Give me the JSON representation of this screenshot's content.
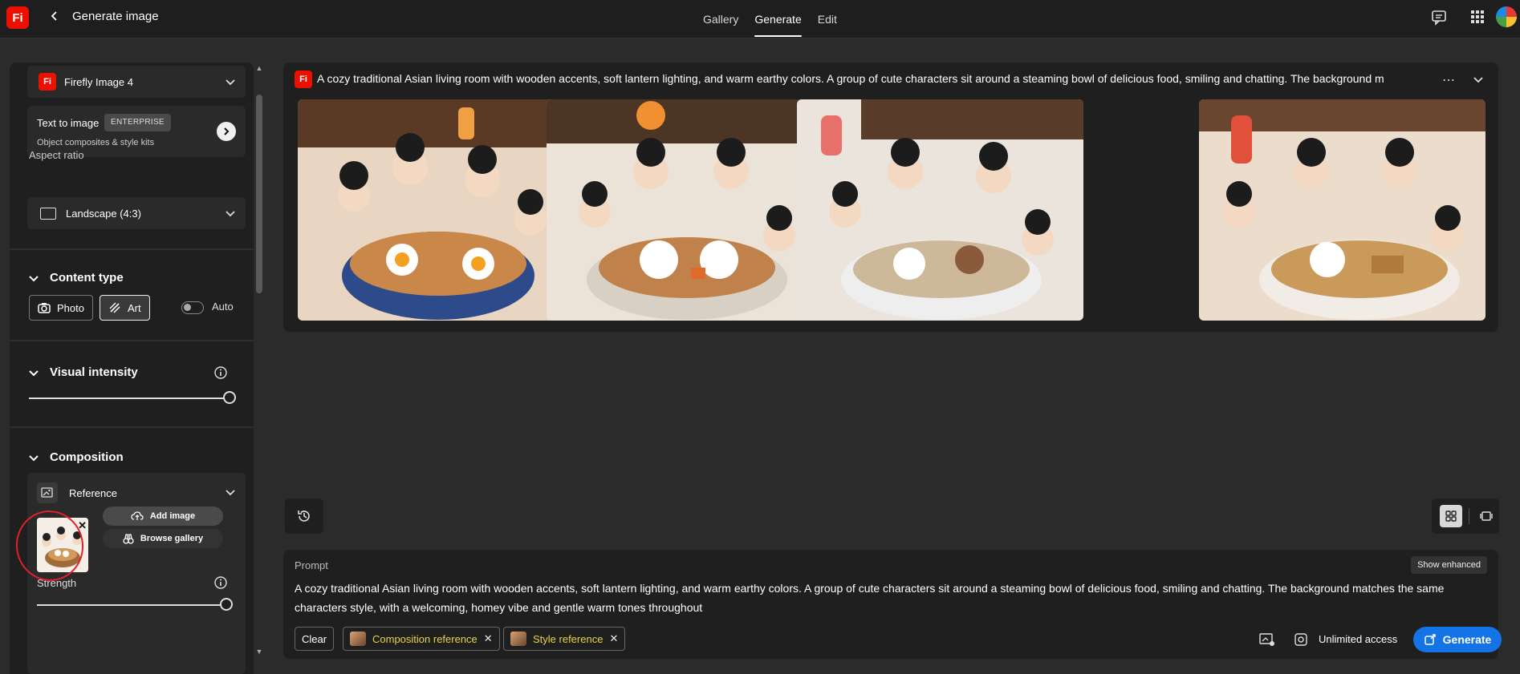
{
  "header": {
    "logo": "Fi",
    "title": "Generate image",
    "tabs": [
      "Gallery",
      "Generate",
      "Edit"
    ],
    "active_tab": "Generate"
  },
  "sidebar": {
    "model": "Firefly Image 4",
    "text_to_image": {
      "title": "Text to image",
      "badge": "ENTERPRISE",
      "subtitle": "Object composites & style kits"
    },
    "aspect_ratio": {
      "label": "Aspect ratio",
      "value": "Landscape (4:3)"
    },
    "content_type": {
      "label": "Content type",
      "options": [
        "Photo",
        "Art"
      ],
      "selected": "Art",
      "auto_label": "Auto",
      "auto_on": false
    },
    "visual_intensity": {
      "label": "Visual intensity",
      "value": 1.0
    },
    "composition": {
      "label": "Composition",
      "reference_label": "Reference",
      "add_image": "Add image",
      "browse_gallery": "Browse gallery",
      "strength_label": "Strength",
      "strength_value": 1.0
    }
  },
  "results": {
    "logo": "Fi",
    "prompt": "A cozy traditional Asian living room with wooden accents, soft lantern lighting, and warm earthy colors. A group of cute characters sit around a steaming bowl of delicious food, smiling and chatting. The background m",
    "more": "⋯",
    "image_count": 4
  },
  "prompt_box": {
    "label": "Prompt",
    "show_enhanced": "Show enhanced",
    "text": "A cozy traditional Asian living room with wooden accents, soft lantern lighting, and warm earthy colors. A group of cute characters sit around a steaming bowl of delicious food, smiling and chatting. The background matches the same characters style, with a welcoming, homey vibe and gentle warm tones throughout",
    "clear": "Clear",
    "chips": [
      "Composition reference",
      "Style reference"
    ],
    "access": "Unlimited access",
    "generate": "Generate"
  },
  "colors": {
    "accent": "#1473e6",
    "brand": "#eb1000",
    "chip_text": "#e6d34a",
    "annotation": "#e0202a"
  }
}
